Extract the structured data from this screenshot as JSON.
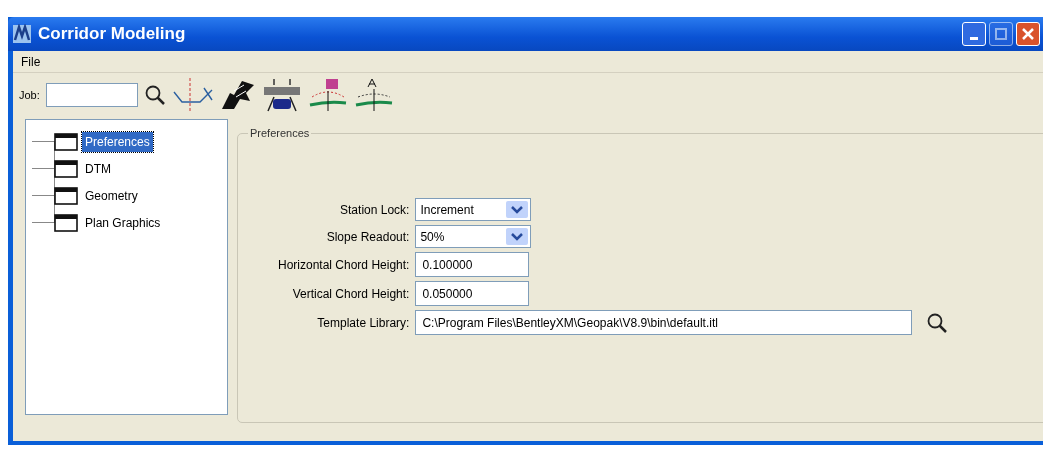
{
  "window": {
    "title": "Corridor Modeling",
    "controls": [
      {
        "kind": "minimize",
        "disabled": false
      },
      {
        "kind": "maximize",
        "disabled": true
      },
      {
        "kind": "close",
        "disabled": false
      }
    ]
  },
  "menu": [
    "File"
  ],
  "toolbar": {
    "job_label": "Job:"
  },
  "tree": [
    {
      "label": "Preferences",
      "selected": true
    },
    {
      "label": "DTM",
      "selected": false
    },
    {
      "label": "Geometry",
      "selected": false
    },
    {
      "label": "Plan Graphics",
      "selected": false
    }
  ],
  "group": {
    "title": "Preferences",
    "fields": [
      {
        "label": "Station Lock:",
        "kind": "select",
        "value": "Increment"
      },
      {
        "label": "Slope Readout:",
        "kind": "select",
        "value": "50%"
      },
      {
        "label": "Horizontal Chord Height:",
        "kind": "text",
        "value": "0.100000"
      },
      {
        "label": "Vertical Chord Height:",
        "kind": "text",
        "value": "0.050000"
      },
      {
        "label": "Template Library:",
        "kind": "path",
        "value": "C:\\Program Files\\BentleyXM\\Geopak\\V8.9\\bin\\default.itl"
      }
    ]
  }
}
